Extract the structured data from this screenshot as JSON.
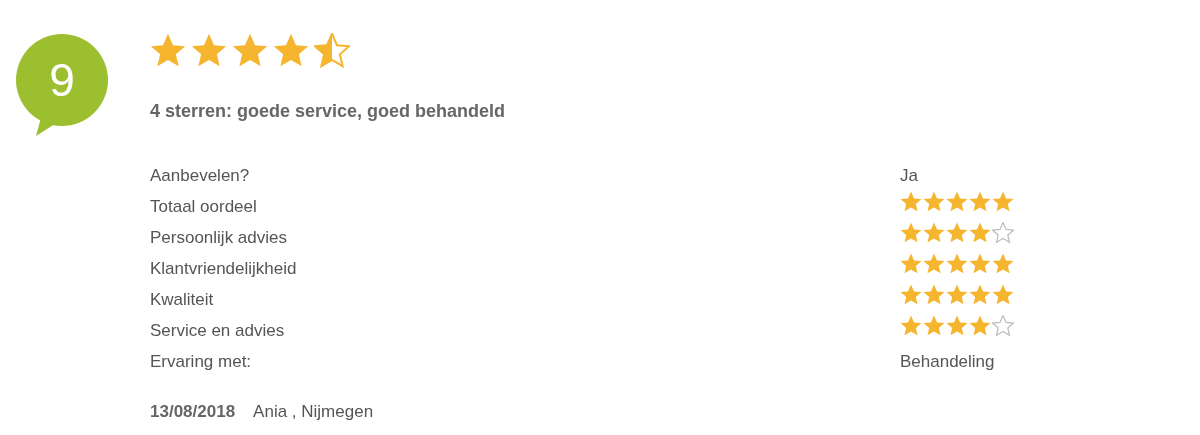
{
  "score": "9",
  "rating": {
    "stars": 4.5
  },
  "title": "4 sterren: goede service, goed behandeld",
  "rows": [
    {
      "label": "Aanbevelen?",
      "kind": "text",
      "value": "Ja"
    },
    {
      "label": "Totaal oordeel",
      "kind": "stars",
      "stars": 5
    },
    {
      "label": "Persoonlijk advies",
      "kind": "stars",
      "stars": 4
    },
    {
      "label": "Klantvriendelijkheid",
      "kind": "stars",
      "stars": 5
    },
    {
      "label": "Kwaliteit",
      "kind": "stars",
      "stars": 5
    },
    {
      "label": "Service en advies",
      "kind": "stars",
      "stars": 4
    },
    {
      "label": "Ervaring met:",
      "kind": "text",
      "value": "Behandeling"
    }
  ],
  "date": "13/08/2018",
  "author": "Ania , Nijmegen"
}
